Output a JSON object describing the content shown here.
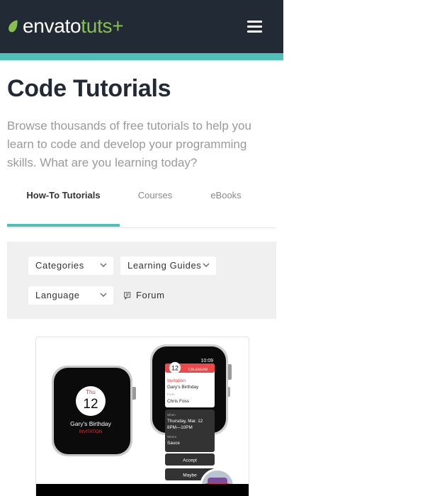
{
  "header": {
    "logo_envato": "envato",
    "logo_tuts": "tuts+",
    "menu_icon": "hamburger-menu-icon",
    "colors": {
      "background": "#222a36",
      "accent_strip": "#4fc0b8",
      "logo_leaf": "#86c14f"
    }
  },
  "page": {
    "title": "Code Tutorials",
    "intro": "Browse thousands of free tutorials to help you learn to code and develop your programming skills. What are you learning today?"
  },
  "tabs": [
    {
      "label": "How-To Tutorials",
      "active": true
    },
    {
      "label": "Courses",
      "active": false
    },
    {
      "label": "eBooks",
      "active": false
    }
  ],
  "filters": {
    "categories": "Categories",
    "learning_guides": "Learning Guides",
    "language": "Language",
    "forum": "Forum"
  },
  "card": {
    "watch_left": {
      "day": "Thu",
      "date": "12",
      "event": "Gary's Birthday",
      "label": "INVITATION"
    },
    "watch_right": {
      "time": "10:09",
      "date": "12",
      "app": "CALENDAR",
      "type": "Invitation",
      "event": "Gary's Birthday",
      "from_label": "From",
      "from_name": "Chris Foss",
      "when_label": "When",
      "when_date": "Thursday, Mar. 12",
      "when_time": "8PM—10PM",
      "where_label": "Where",
      "where_place": "Sauce",
      "accept": "Accept",
      "maybe": "Maybe"
    }
  }
}
